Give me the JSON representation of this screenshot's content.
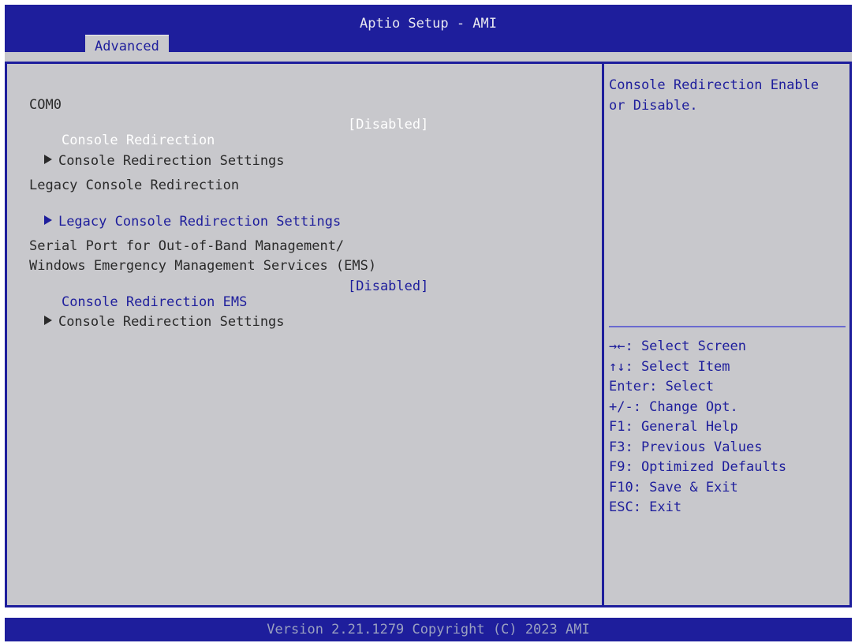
{
  "app": {
    "title": "Aptio Setup - AMI",
    "tab": "Advanced"
  },
  "main": {
    "com_label": "COM0",
    "console_redirection": {
      "label": "Console Redirection",
      "value": "[Disabled]"
    },
    "console_redirection_settings": "Console Redirection Settings",
    "legacy_heading": "Legacy Console Redirection",
    "legacy_settings": "Legacy Console Redirection Settings",
    "oob_heading_1": "Serial Port for Out-of-Band Management/",
    "oob_heading_2": "Windows Emergency Management Services (EMS)",
    "console_redirection_ems": {
      "label": "Console Redirection EMS",
      "value": "[Disabled]"
    },
    "ems_settings": "Console Redirection Settings"
  },
  "help": {
    "description": "Console Redirection Enable or Disable.",
    "keys": [
      "→←: Select Screen",
      "↑↓: Select Item",
      "Enter: Select",
      "+/-: Change Opt.",
      "F1: General Help",
      "F3: Previous Values",
      "F9: Optimized Defaults",
      "F10: Save & Exit",
      "ESC: Exit"
    ]
  },
  "footer": {
    "version": "Version 2.21.1279 Copyright (C) 2023 AMI"
  },
  "colors": {
    "accent_blue": "#1e1e9c",
    "panel_gray": "#c8c8cc",
    "highlight_white": "#ffffff"
  }
}
